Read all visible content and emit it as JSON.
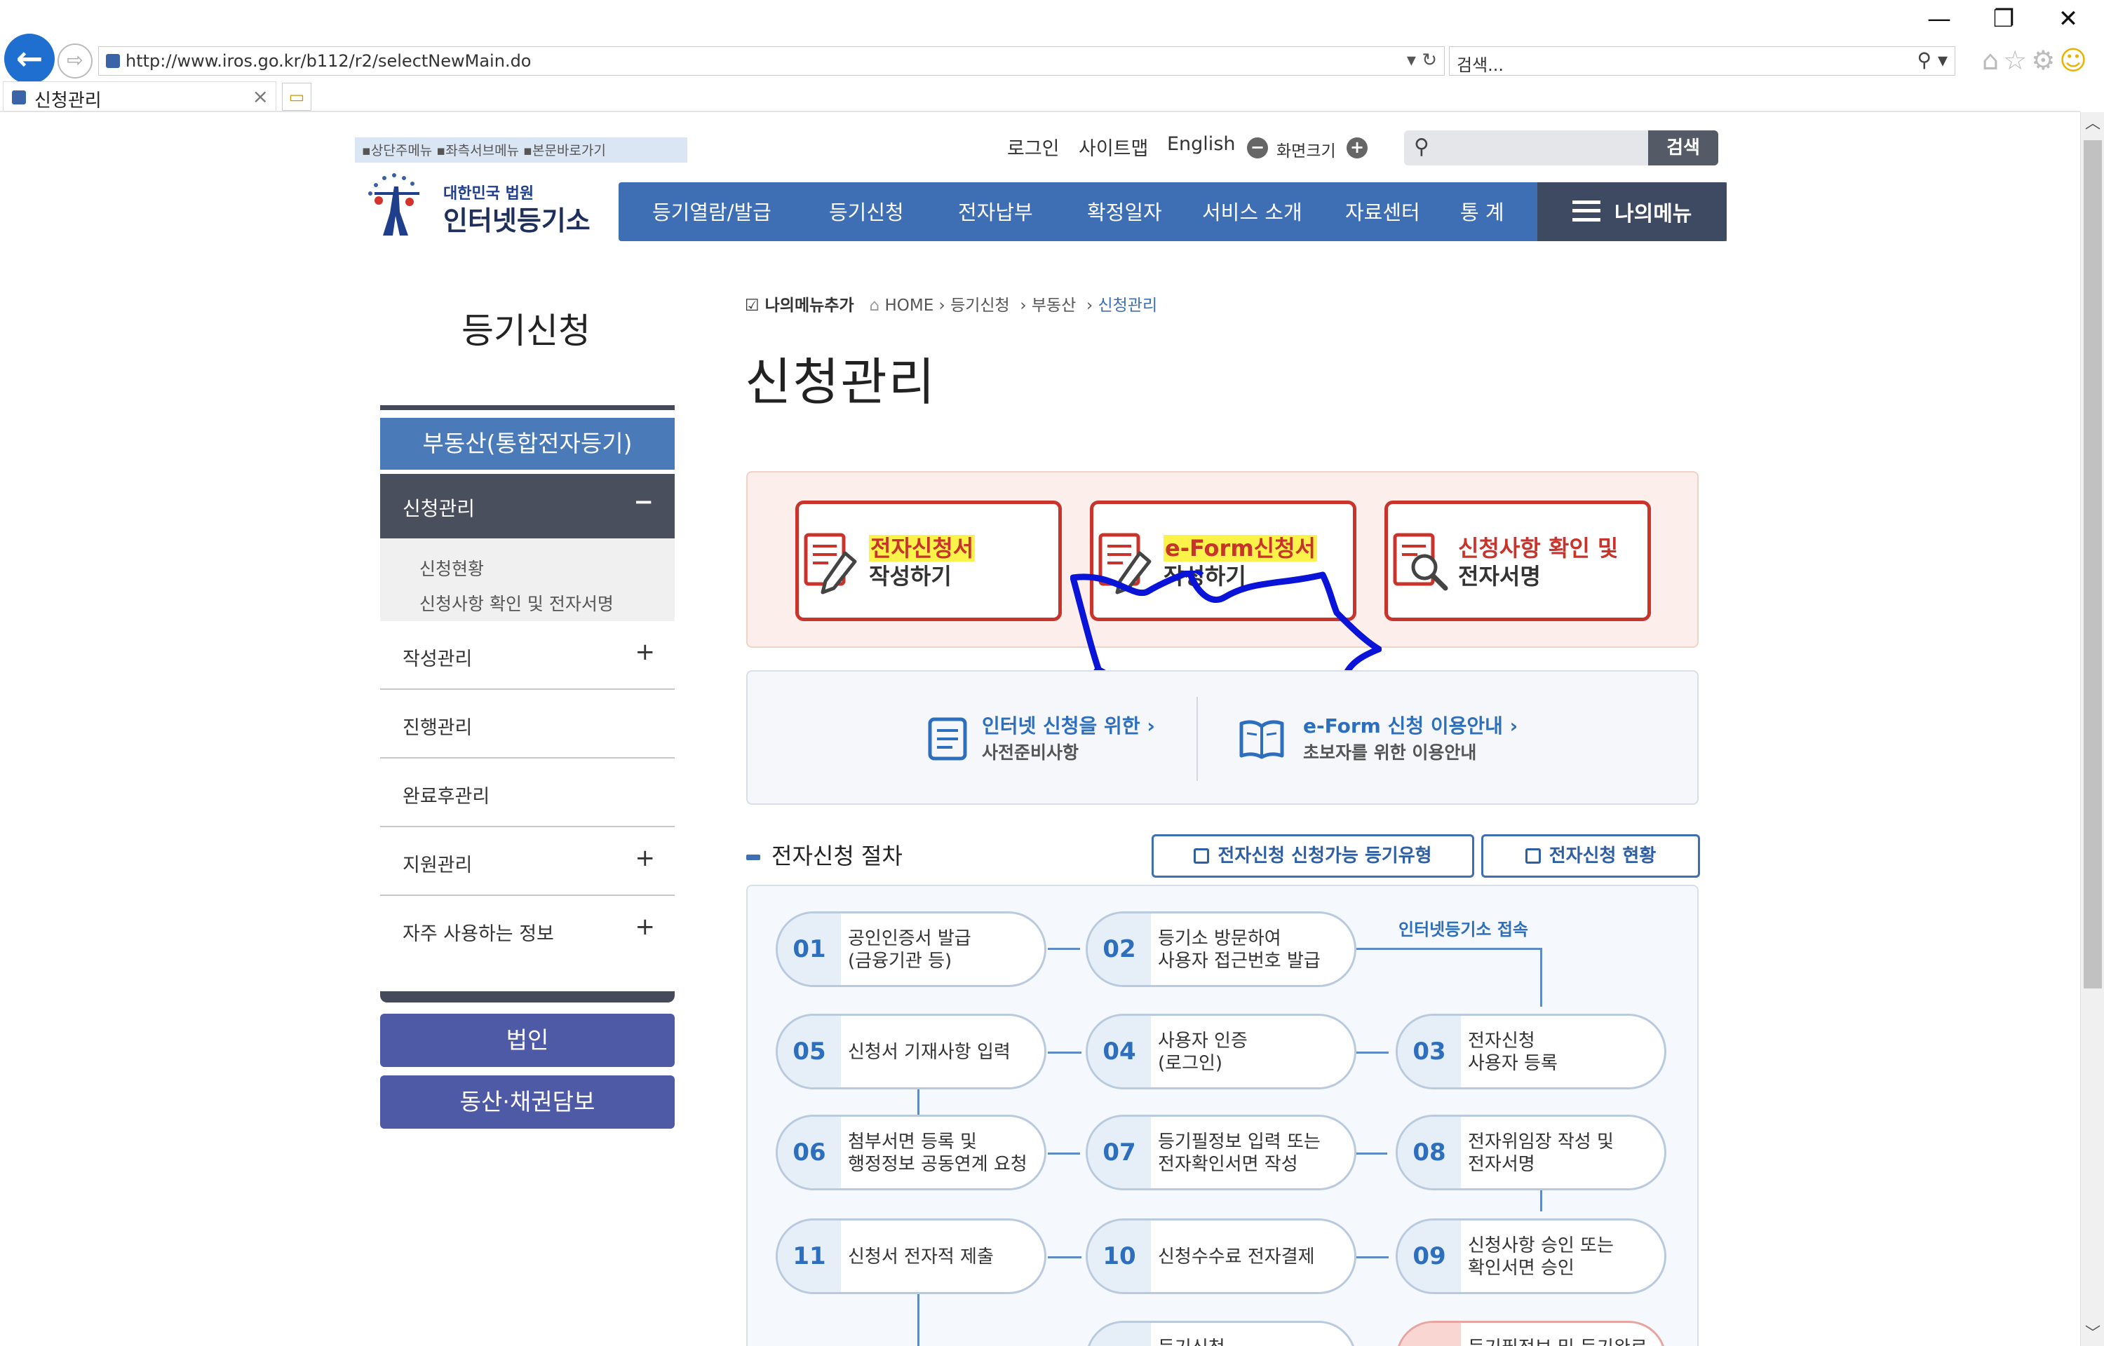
{
  "browser": {
    "window_controls": {
      "minimize": "—",
      "restore": "❐",
      "close": "✕"
    },
    "url": "http://www.iros.go.kr/b112/r2/selectNewMain.do",
    "search_placeholder": "검색...",
    "tab_title": "신청관리"
  },
  "header": {
    "skip_links": "▪상단주메뉴 ▪좌측서브메뉴 ▪본문바로가기",
    "util": {
      "login": "로그인",
      "sitemap": "사이트맵",
      "english": "English",
      "font_size": "화면크기"
    },
    "search_button": "검색",
    "logo": {
      "line1": "대한민국 법원",
      "line2": "인터넷등기소"
    },
    "gnb": [
      "등기열람/발급",
      "등기신청",
      "전자납부",
      "확정일자",
      "서비스 소개",
      "자료센터",
      "통 계"
    ],
    "my_menu": "나의메뉴"
  },
  "sidebar": {
    "title": "등기신청",
    "section": "부동산(통합전자등기)",
    "active_item": {
      "label": "신청관리",
      "toggle": "−"
    },
    "sub_items": [
      "신청현황",
      "신청사항 확인 및 전자서명"
    ],
    "items": [
      {
        "label": "작성관리",
        "toggle": "+"
      },
      {
        "label": "진행관리",
        "toggle": ""
      },
      {
        "label": "완료후관리",
        "toggle": ""
      },
      {
        "label": "지원관리",
        "toggle": "+"
      },
      {
        "label": "자주 사용하는 정보",
        "toggle": "+"
      }
    ],
    "buttons": [
      "법인",
      "동산·채권담보"
    ]
  },
  "main": {
    "breadcrumb": {
      "add_menu": "나의메뉴추가",
      "home": "HOME",
      "b1": "등기신청",
      "b2": "부동산",
      "current": "신청관리"
    },
    "title": "신청관리",
    "cards": [
      {
        "line1": "전자신청서",
        "line2": "작성하기"
      },
      {
        "line1": "e-Form신청서",
        "line2": "작성하기"
      },
      {
        "line1": "신청사항 확인 및",
        "line2": "전자서명"
      }
    ],
    "guides": [
      {
        "title": "인터넷 신청을 위한",
        "sub": "사전준비사항"
      },
      {
        "title": "e-Form 신청 이용안내",
        "sub": "초보자를 위한 이용안내"
      }
    ],
    "section_title": "전자신청 절차",
    "section_buttons": [
      "전자신청 신청가능 등기유형",
      "전자신청 현황"
    ],
    "flow_note": "인터넷등기소 접속",
    "steps": [
      {
        "num": "01",
        "label": "공인인증서 발급\n(금융기관 등)"
      },
      {
        "num": "02",
        "label": "등기소 방문하여\n사용자 접근번호 발급"
      },
      {
        "num": "03",
        "label": "전자신청\n사용자 등록"
      },
      {
        "num": "04",
        "label": "사용자 인증\n(로그인)"
      },
      {
        "num": "05",
        "label": "신청서 기재사항 입력"
      },
      {
        "num": "06",
        "label": "첨부서면 등록 및\n행정정보 공동연계 요청"
      },
      {
        "num": "07",
        "label": "등기필정보 입력 또는\n전자확인서면 작성"
      },
      {
        "num": "08",
        "label": "전자위임장 작성 및\n전자서명"
      },
      {
        "num": "09",
        "label": "신청사항 승인 또는\n확인서면 승인"
      },
      {
        "num": "10",
        "label": "신청수수료 전자결제"
      },
      {
        "num": "11",
        "label": "신청서 전자적 제출"
      },
      {
        "num": "",
        "label": "등기신청"
      },
      {
        "num": "",
        "label": "등기필정보 및 등기완료"
      }
    ]
  },
  "colors": {
    "brand_blue": "#3e6eb4",
    "accent_red": "#c8342b",
    "highlight": "#fbf24a",
    "scribble": "#0a14d8"
  }
}
